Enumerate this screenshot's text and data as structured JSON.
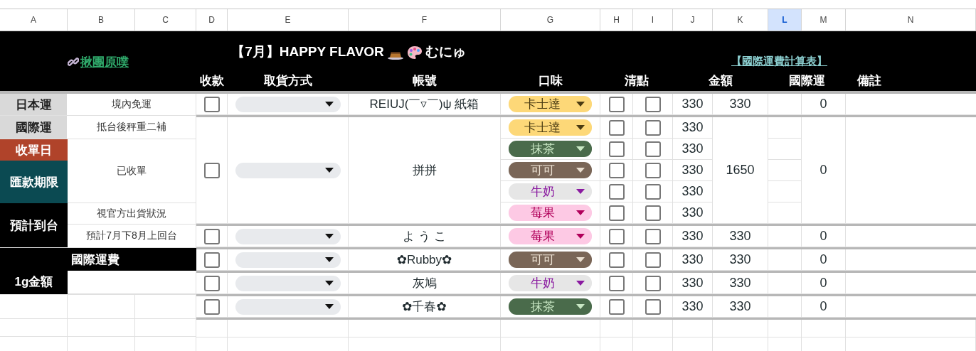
{
  "columns": [
    {
      "letter": "A",
      "selected": false
    },
    {
      "letter": "B",
      "selected": false
    },
    {
      "letter": "C",
      "selected": false
    },
    {
      "letter": "D",
      "selected": false
    },
    {
      "letter": "E",
      "selected": false
    },
    {
      "letter": "F",
      "selected": false
    },
    {
      "letter": "G",
      "selected": false
    },
    {
      "letter": "H",
      "selected": false
    },
    {
      "letter": "I",
      "selected": false
    },
    {
      "letter": "J",
      "selected": false
    },
    {
      "letter": "K",
      "selected": false
    },
    {
      "letter": "L",
      "selected": true
    },
    {
      "letter": "M",
      "selected": false
    },
    {
      "letter": "N",
      "selected": false
    }
  ],
  "header": {
    "link": "揪團原噗",
    "title": "【7月】HAPPY FLAVOR",
    "title_suffix": "むにゅ",
    "calc_link": "【國際運費計算表】",
    "headings": [
      "收款",
      "取貨方式",
      "帳號",
      "口味",
      "清點",
      "金額",
      "國際運",
      "備註"
    ]
  },
  "info": {
    "japan_label": "日本運",
    "japan_value": "境內免運",
    "intl_label": "國際運",
    "intl_value": "抵台後秤重二補",
    "close_label": "收單日",
    "deadline_label": "匯款期限",
    "status_value": "已收單",
    "arrival_label": "預計到台",
    "arrival_note": "視官方出貨狀況",
    "arrival_value": "預計7月下8月上回台",
    "gram_label": "1g金額",
    "fee_label": "國際運費"
  },
  "orders": [
    {
      "paid": false,
      "account": "REIUJ(￣▿￣)ψ 紙箱",
      "total": "330",
      "intl": "0",
      "items": [
        {
          "flavor": "卡士達",
          "color": "#fdd878",
          "checks": [
            {
              "checked": false
            },
            {
              "checked": false
            }
          ],
          "price": "330"
        }
      ]
    },
    {
      "paid": false,
      "account": "拼拼",
      "total": "1650",
      "intl": "0",
      "items": [
        {
          "flavor": "卡士達",
          "color": "#fdd878",
          "checks": [
            {
              "checked": false
            },
            {
              "checked": false
            }
          ],
          "price": "330"
        },
        {
          "flavor": "抹茶",
          "color": "#4a6b4b",
          "checks": [
            {
              "checked": false
            },
            {
              "checked": false
            }
          ],
          "price": "330"
        },
        {
          "flavor": "可可",
          "color": "#7a6657",
          "checks": [
            {
              "checked": false
            },
            {
              "checked": false
            }
          ],
          "price": "330"
        },
        {
          "flavor": "牛奶",
          "color": "#e6e6e6",
          "checks": [
            {
              "checked": false
            },
            {
              "checked": false
            }
          ],
          "price": "330"
        },
        {
          "flavor": "莓果",
          "color": "#fdc9e4",
          "checks": [
            {
              "checked": false
            },
            {
              "checked": false
            }
          ],
          "price": "330"
        }
      ]
    },
    {
      "paid": false,
      "account": "よ う こ",
      "total": "330",
      "intl": "0",
      "items": [
        {
          "flavor": "莓果",
          "color": "#fdc9e4",
          "checks": [
            {
              "checked": false
            },
            {
              "checked": false
            }
          ],
          "price": "330"
        }
      ]
    },
    {
      "paid": false,
      "account": "✿Rubby✿",
      "total": "330",
      "intl": "0",
      "items": [
        {
          "flavor": "可可",
          "color": "#7a6657",
          "checks": [
            {
              "checked": false
            },
            {
              "checked": false
            }
          ],
          "price": "330"
        }
      ]
    },
    {
      "paid": false,
      "account": "灰鳩",
      "total": "330",
      "intl": "0",
      "items": [
        {
          "flavor": "牛奶",
          "color": "#e6e6e6",
          "checks": [
            {
              "checked": false
            },
            {
              "checked": false
            }
          ],
          "price": "330"
        }
      ]
    },
    {
      "paid": false,
      "account": "✿千春✿",
      "total": "330",
      "intl": "0",
      "items": [
        {
          "flavor": "抹茶",
          "color": "#4a6b4b",
          "checks": [
            {
              "checked": false
            },
            {
              "checked": false
            }
          ],
          "price": "330"
        }
      ]
    }
  ]
}
